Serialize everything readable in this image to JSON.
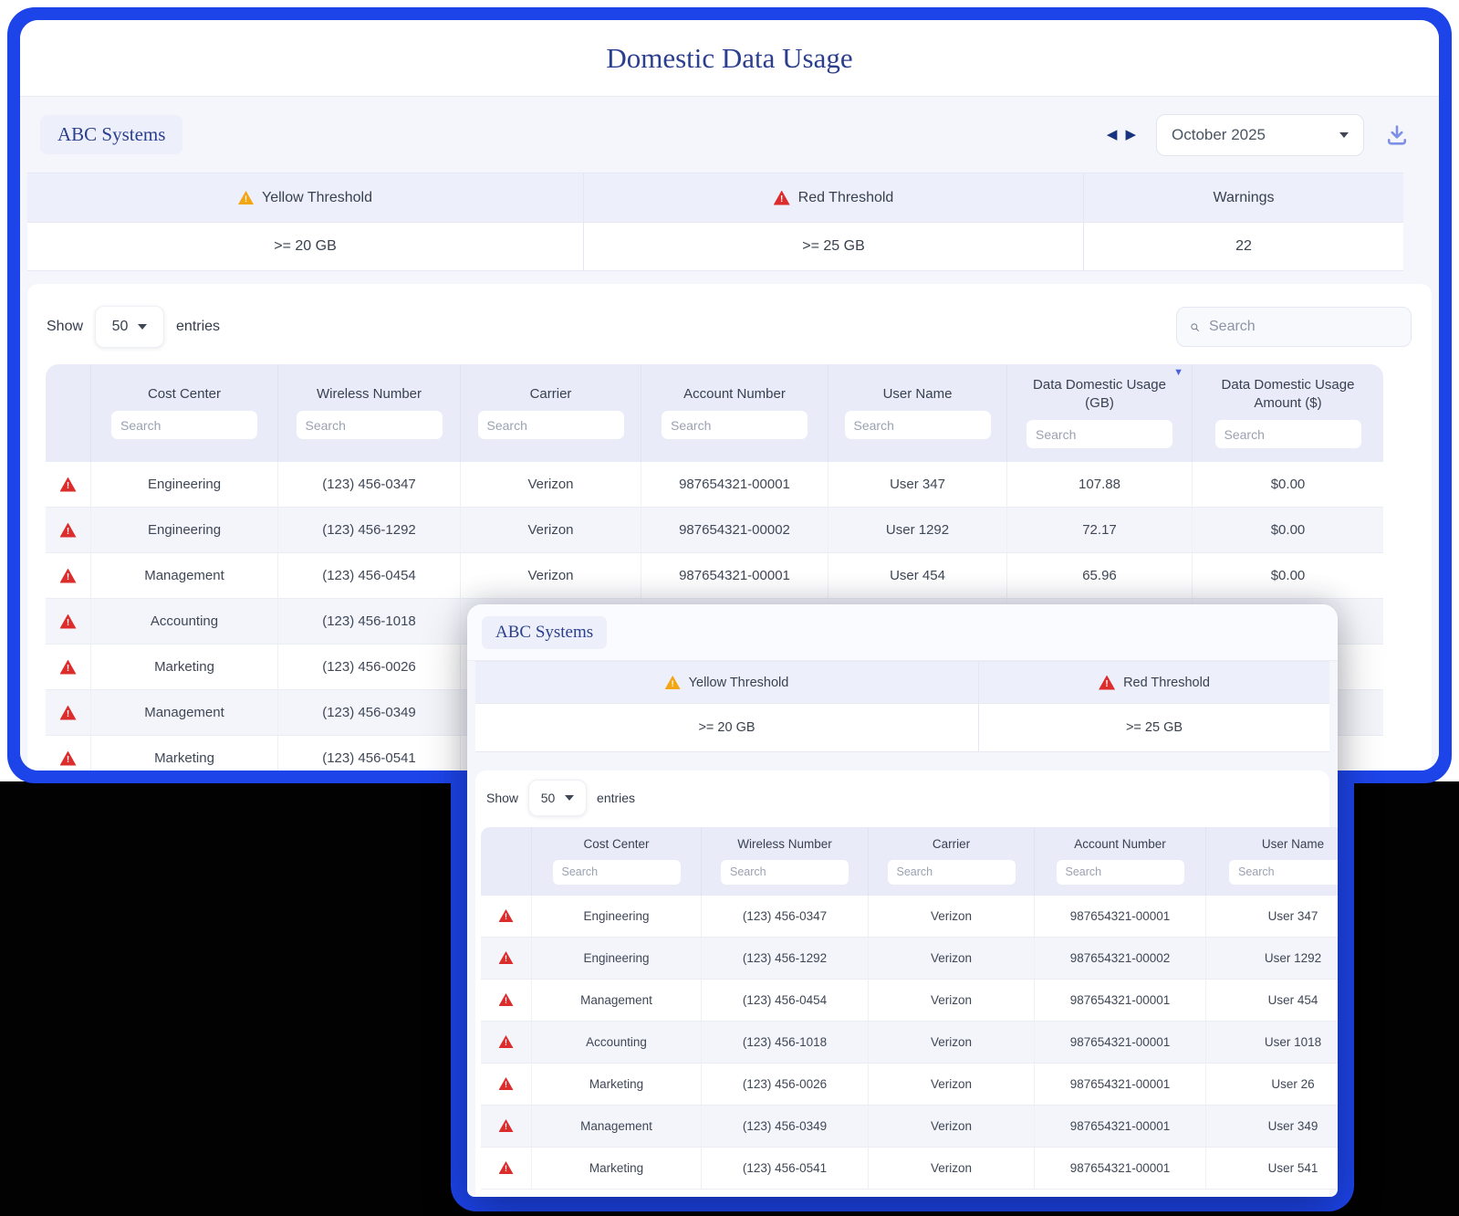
{
  "colors": {
    "frame_blue": "#1d44e9",
    "navy_text": "#2b3f8f",
    "yellow_warning": "#f2a614",
    "red_warning": "#dc2c2c",
    "header_lavender": "#e9ecf8"
  },
  "icons": {
    "yellow_threshold": "warning-triangle",
    "red_threshold": "warning-triangle",
    "row_warning": "warning-triangle",
    "previous_month": "left-solid-arrow",
    "next_month": "right-solid-arrow",
    "month_dropdown": "chevron-down",
    "download": "download-tray-arrow",
    "search": "magnifier",
    "sort_usage_gb": "triangle-down"
  },
  "header": {
    "title": "Domestic Data Usage"
  },
  "toolbar": {
    "company_badge": "ABC Systems",
    "month_selector_value": "October 2025"
  },
  "thresholds": {
    "yellow_label": "Yellow Threshold",
    "yellow_value": ">= 20 GB",
    "red_label": "Red Threshold",
    "red_value": ">= 25 GB",
    "warnings_label": "Warnings",
    "warnings_value": "22"
  },
  "controls": {
    "show_label": "Show",
    "page_size_value": "50",
    "entries_label": "entries",
    "search_placeholder": "Search"
  },
  "main_table": {
    "column_search_placeholder": "Search",
    "columns": [
      {
        "key": "icon",
        "label": ""
      },
      {
        "key": "cost_center",
        "label": "Cost Center"
      },
      {
        "key": "wireless_number",
        "label": "Wireless Number"
      },
      {
        "key": "carrier",
        "label": "Carrier"
      },
      {
        "key": "account_number",
        "label": "Account Number"
      },
      {
        "key": "user_name",
        "label": "User Name"
      },
      {
        "key": "usage_gb",
        "label": "Data Domestic Usage (GB)",
        "sorted": "desc"
      },
      {
        "key": "usage_amount",
        "label": "Data Domestic Usage Amount ($)"
      }
    ],
    "rows": [
      {
        "warning": true,
        "cost_center": "Engineering",
        "wireless_number": "(123) 456-0347",
        "carrier": "Verizon",
        "account_number": "987654321-00001",
        "user_name": "User 347",
        "usage_gb": "107.88",
        "usage_amount": "$0.00"
      },
      {
        "warning": true,
        "cost_center": "Engineering",
        "wireless_number": "(123) 456-1292",
        "carrier": "Verizon",
        "account_number": "987654321-00002",
        "user_name": "User 1292",
        "usage_gb": "72.17",
        "usage_amount": "$0.00"
      },
      {
        "warning": true,
        "cost_center": "Management",
        "wireless_number": "(123) 456-0454",
        "carrier": "Verizon",
        "account_number": "987654321-00001",
        "user_name": "User 454",
        "usage_gb": "65.96",
        "usage_amount": "$0.00"
      },
      {
        "warning": true,
        "cost_center": "Accounting",
        "wireless_number": "(123) 456-1018",
        "carrier": "Verizon",
        "account_number": "987654321-00001",
        "user_name": "User 1018",
        "usage_gb": "",
        "usage_amount": ""
      },
      {
        "warning": true,
        "cost_center": "Marketing",
        "wireless_number": "(123) 456-0026",
        "carrier": "Verizon",
        "account_number": "987654321-00001",
        "user_name": "User 26",
        "usage_gb": "",
        "usage_amount": ""
      },
      {
        "warning": true,
        "cost_center": "Management",
        "wireless_number": "(123) 456-0349",
        "carrier": "Verizon",
        "account_number": "987654321-00001",
        "user_name": "User 349",
        "usage_gb": "",
        "usage_amount": ""
      },
      {
        "warning": true,
        "cost_center": "Marketing",
        "wireless_number": "(123) 456-0541",
        "carrier": "Verizon",
        "account_number": "987654321-00001",
        "user_name": "User 541",
        "usage_gb": "",
        "usage_amount": ""
      }
    ]
  },
  "overlay": {
    "company_badge": "ABC Systems",
    "thresholds": {
      "yellow_label": "Yellow Threshold",
      "yellow_value": ">= 20 GB",
      "red_label": "Red Threshold",
      "red_value": ">= 25 GB"
    },
    "controls": {
      "show_label": "Show",
      "page_size_value": "50",
      "entries_label": "entries"
    },
    "table": {
      "column_search_placeholder": "Search",
      "columns": [
        {
          "key": "icon",
          "label": ""
        },
        {
          "key": "cost_center",
          "label": "Cost Center"
        },
        {
          "key": "wireless_number",
          "label": "Wireless Number"
        },
        {
          "key": "carrier",
          "label": "Carrier"
        },
        {
          "key": "account_number",
          "label": "Account Number"
        },
        {
          "key": "user_name",
          "label": "User Name"
        }
      ],
      "rows": [
        {
          "warning": true,
          "cost_center": "Engineering",
          "wireless_number": "(123) 456-0347",
          "carrier": "Verizon",
          "account_number": "987654321-00001",
          "user_name": "User 347"
        },
        {
          "warning": true,
          "cost_center": "Engineering",
          "wireless_number": "(123) 456-1292",
          "carrier": "Verizon",
          "account_number": "987654321-00002",
          "user_name": "User 1292"
        },
        {
          "warning": true,
          "cost_center": "Management",
          "wireless_number": "(123) 456-0454",
          "carrier": "Verizon",
          "account_number": "987654321-00001",
          "user_name": "User 454"
        },
        {
          "warning": true,
          "cost_center": "Accounting",
          "wireless_number": "(123) 456-1018",
          "carrier": "Verizon",
          "account_number": "987654321-00001",
          "user_name": "User 1018"
        },
        {
          "warning": true,
          "cost_center": "Marketing",
          "wireless_number": "(123) 456-0026",
          "carrier": "Verizon",
          "account_number": "987654321-00001",
          "user_name": "User 26"
        },
        {
          "warning": true,
          "cost_center": "Management",
          "wireless_number": "(123) 456-0349",
          "carrier": "Verizon",
          "account_number": "987654321-00001",
          "user_name": "User 349"
        },
        {
          "warning": true,
          "cost_center": "Marketing",
          "wireless_number": "(123) 456-0541",
          "carrier": "Verizon",
          "account_number": "987654321-00001",
          "user_name": "User 541"
        }
      ]
    }
  }
}
